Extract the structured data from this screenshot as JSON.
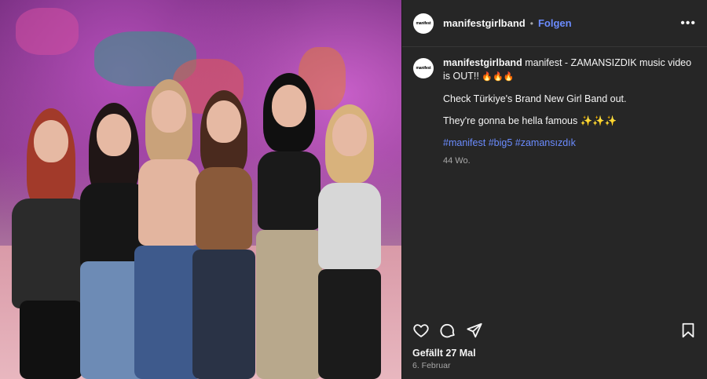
{
  "post": {
    "account": {
      "avatar_text": "manifest",
      "username": "manifestgirlband",
      "dot": "•",
      "follow_label": "Folgen",
      "more_label": "•••"
    },
    "caption": {
      "username": "manifestgirlband",
      "line1": "manifest - ZAMANSIZDIK music video is OUT!!",
      "emoji1": "🔥🔥🔥",
      "line2": "Check Türkiye's Brand New Girl Band out.",
      "line3": "They're gonna be hella famous ✨✨✨",
      "hashtags": [
        "#manifest",
        "#big5",
        "#zamansızdık"
      ],
      "age": "44 Wo."
    },
    "actions": {
      "like_icon": "heart-icon",
      "comment_icon": "comment-icon",
      "share_icon": "share-icon",
      "save_icon": "bookmark-icon"
    },
    "likes": "Gefällt 27 Mal",
    "date": "6. Februar"
  },
  "colors": {
    "panel_bg": "#262626",
    "link_blue": "#6b8cff",
    "muted": "#a8a8a8"
  }
}
